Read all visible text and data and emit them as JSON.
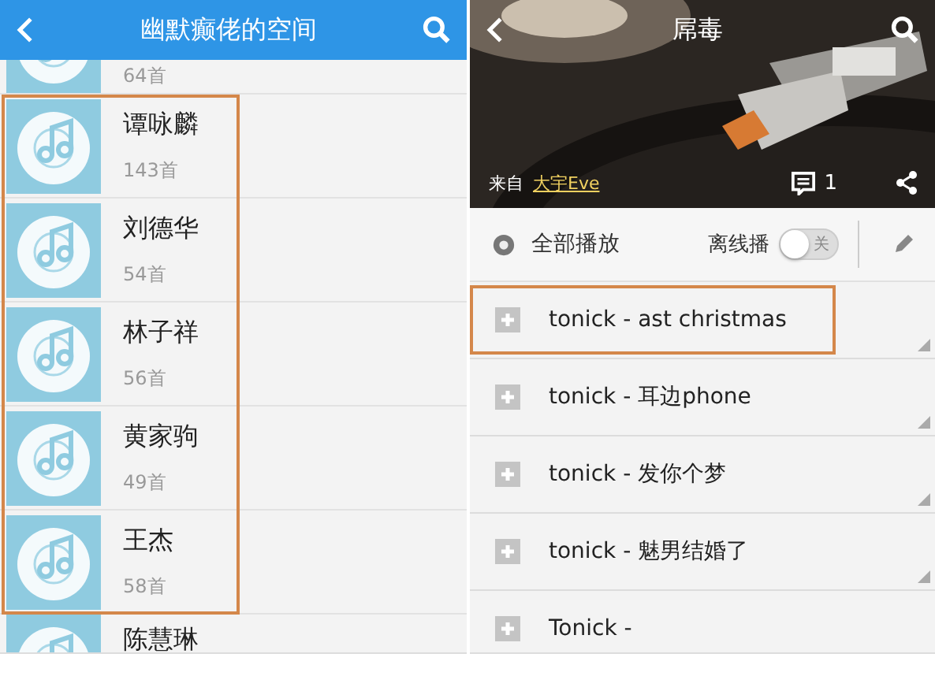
{
  "left": {
    "header": {
      "title": "幽默癫佬的空间"
    },
    "artists": [
      {
        "count": "64首",
        "highlighted": false
      },
      {
        "name": "谭咏麟",
        "count": "143首",
        "highlighted": true
      },
      {
        "name": "刘德华",
        "count": "54首",
        "highlighted": true
      },
      {
        "name": "林子祥",
        "count": "56首",
        "highlighted": true
      },
      {
        "name": "黄家驹",
        "count": "49首",
        "highlighted": true
      },
      {
        "name": "王杰",
        "count": "58首",
        "highlighted": true
      },
      {
        "name": "陈慧琳",
        "highlighted": false
      }
    ]
  },
  "right": {
    "header": {
      "title": "屌毒",
      "source_label": "来自",
      "source_user": "大宇Eve",
      "comment_count": "1"
    },
    "toolbar": {
      "play_all": "全部播放",
      "offline_label": "离线播",
      "offline_on": false,
      "switch_text": "关"
    },
    "songs": [
      {
        "title": "tonick - ast christmas",
        "highlighted": true
      },
      {
        "title": "tonick - 耳边phone",
        "highlighted": false
      },
      {
        "title": "tonick - 发你个梦",
        "highlighted": false
      },
      {
        "title": "tonick - 魅男结婚了",
        "highlighted": false
      },
      {
        "title": "Tonick -",
        "highlighted": false
      }
    ]
  }
}
